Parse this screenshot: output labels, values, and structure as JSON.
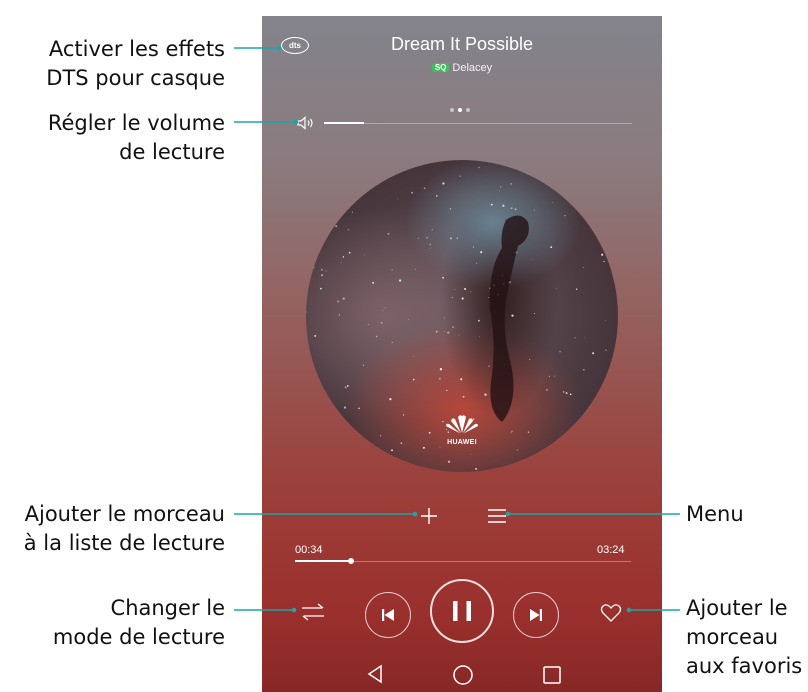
{
  "player": {
    "song_title": "Dream It Possible",
    "quality_badge": "SQ",
    "artist": "Delacey",
    "page_indicator": {
      "count": 3,
      "active": 1
    },
    "dts_label": "dts",
    "volume_level": 0.13,
    "art_logo": "HUAWEI",
    "elapsed": "00:34",
    "duration": "03:24",
    "progress": 0.167,
    "playing": true
  },
  "icons": {
    "dts": "dts-icon",
    "volume": "volume-icon",
    "add": "plus-icon",
    "menu": "menu-icon",
    "shuffle": "play-mode-icon",
    "previous": "skip-previous-icon",
    "pause": "pause-icon",
    "next": "skip-next-icon",
    "favorite": "heart-icon",
    "nav_back": "back-triangle-icon",
    "nav_home": "home-circle-icon",
    "nav_recent": "recent-square-icon"
  },
  "annotations": {
    "dts": [
      "Activer les effets",
      "DTS pour casque"
    ],
    "volume": [
      "Régler le volume",
      "de lecture"
    ],
    "add_playlist": [
      "Ajouter le morceau",
      "à la liste de lecture"
    ],
    "play_mode": [
      "Changer le",
      "mode de lecture"
    ],
    "menu": [
      "Menu"
    ],
    "favorite": [
      "Ajouter le",
      "morceau",
      "aux favoris"
    ]
  },
  "colors": {
    "leader_line": "#1aa6a6",
    "sq_badge": "#3fbf5a",
    "text": "#111111"
  }
}
